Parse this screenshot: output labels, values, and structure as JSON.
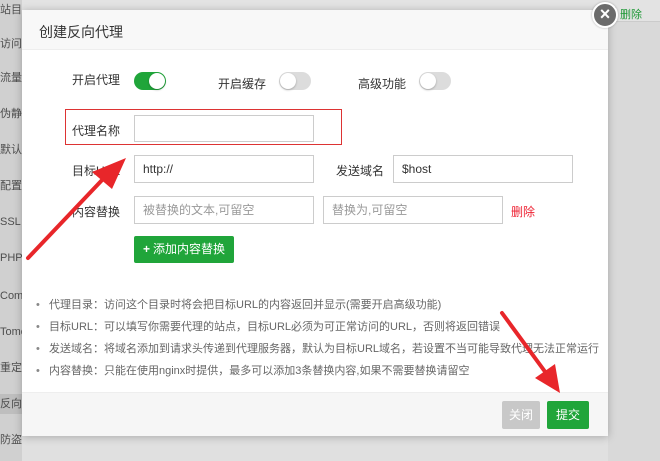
{
  "background": {
    "sidebar_items": [
      "站目录",
      "访问限",
      "流量限",
      "伪静态",
      "默认文",
      "配置文",
      "SSL",
      "PHP版",
      "Composer",
      "Tomcat",
      "重定向",
      "反向代",
      "防盗链"
    ],
    "delete_link": "删除"
  },
  "dialog": {
    "title": "创建反向代理",
    "close_icon": "×",
    "toggles": {
      "enable_proxy": {
        "label": "开启代理",
        "on": true
      },
      "enable_cache": {
        "label": "开启缓存",
        "on": false
      },
      "advanced": {
        "label": "高级功能",
        "on": false
      }
    },
    "fields": {
      "proxy_name": {
        "label": "代理名称",
        "value": "",
        "placeholder": ""
      },
      "target_url": {
        "label": "目标URL",
        "value": "http://"
      },
      "send_domain": {
        "label": "发送域名",
        "value": "$host"
      },
      "content_replace": {
        "label": "内容替换",
        "find_placeholder": "被替换的文本,可留空",
        "replace_placeholder": "替换为,可留空",
        "delete_label": "删除"
      }
    },
    "add_button": {
      "icon": "+",
      "label": "添加内容替换"
    },
    "tips": [
      "代理目录：访问这个目录时将会把目标URL的内容返回并显示(需要开启高级功能)",
      "目标URL：可以填写你需要代理的站点，目标URL必须为可正常访问的URL，否则将返回错误",
      "发送域名：将域名添加到请求头传递到代理服务器，默认为目标URL域名，若设置不当可能导致代理无法正常运行",
      "内容替换：只能在使用nginx时提供，最多可以添加3条替换内容,如果不需要替换请留空"
    ],
    "footer": {
      "close_label": "关闭",
      "submit_label": "提交"
    }
  },
  "colors": {
    "accent": "#20a53a",
    "danger": "#ee2233",
    "annotation_arrow": "#e8262a"
  }
}
